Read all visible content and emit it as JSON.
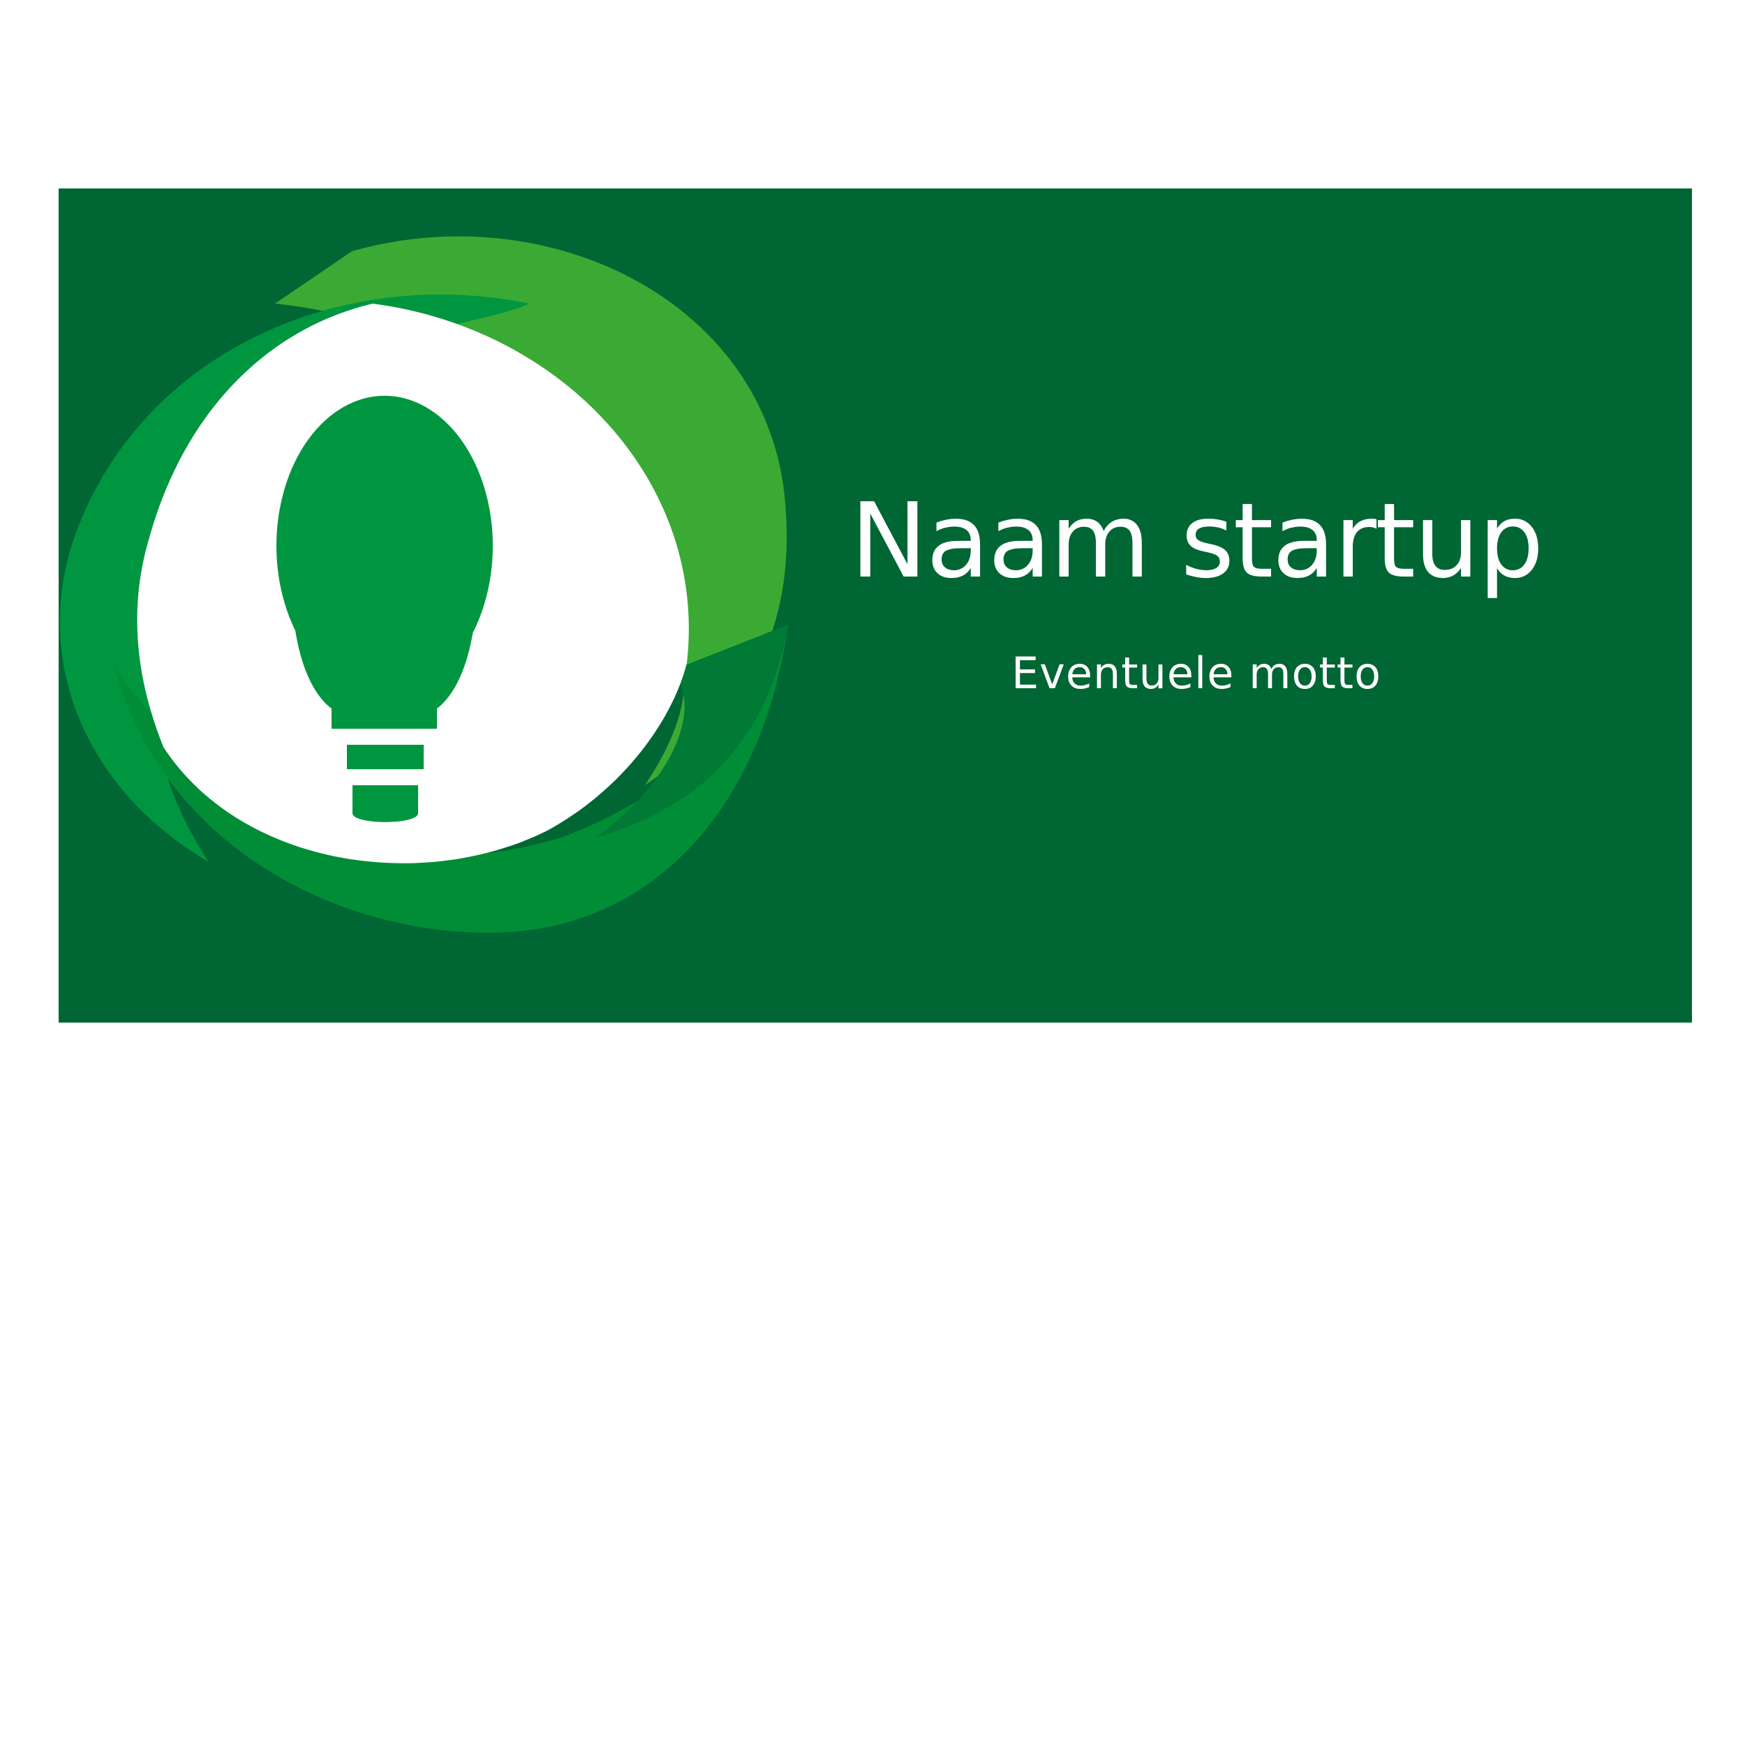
{
  "brand": {
    "name": "Naam startup",
    "motto": "Eventuele motto"
  },
  "colors": {
    "banner_background": "#006634",
    "page_background": "#ffffff",
    "ring_light": "#3aaa35",
    "ring_mid": "#009640",
    "ring_dark": "#008d36",
    "bulb": "#009640",
    "text": "#ffffff"
  },
  "icons": {
    "logo": "lightbulb-in-green-swirl-icon"
  }
}
